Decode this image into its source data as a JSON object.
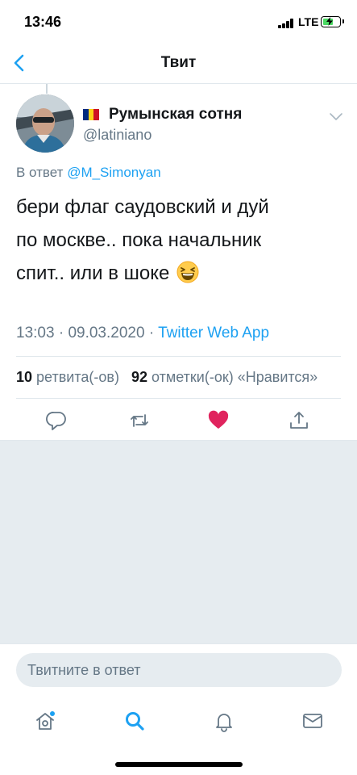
{
  "status_bar": {
    "time": "13:46",
    "network": "LTE",
    "battery_color": "#4cd964"
  },
  "header": {
    "title": "Твит"
  },
  "tweet": {
    "author_name": "Румынская сотня",
    "author_handle": "@latiniano",
    "reply_prefix": "В ответ",
    "reply_to": "@M_Simonyan",
    "text_lines": [
      "бери флаг саудовский и дуй",
      "по москве.. пока начальник",
      "спит.. или в шоке"
    ],
    "time": "13:03",
    "date": "09.03.2020",
    "separator": "·",
    "source": "Twitter Web App",
    "retweets_count": "10",
    "retweets_label": "ретвита(-ов)",
    "likes_count": "92",
    "likes_label": "отметки(-ок)",
    "likes_trailing": "«Нравится»",
    "liked": true
  },
  "reply_box": {
    "placeholder": "Твитните в ответ"
  },
  "tabs": [
    "home-icon",
    "search-icon",
    "notifications-icon",
    "messages-icon"
  ],
  "colors": {
    "accent": "#1da1f2",
    "like": "#e0245e",
    "secondary_text": "#657786",
    "background_gray": "#e6ecf0",
    "flag": [
      "#002b7f",
      "#fcd116",
      "#ce1126"
    ]
  }
}
